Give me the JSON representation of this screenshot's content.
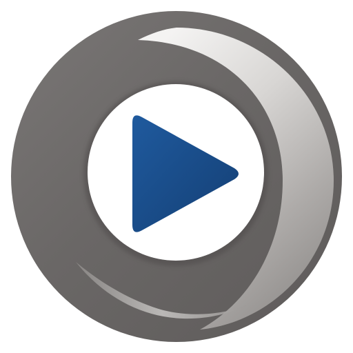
{
  "app": {
    "icon": "play-icon",
    "ring_icon": "ring-logo-icon"
  },
  "colors": {
    "background": "#ffffff",
    "ring_dark": "#6f6c6b",
    "ring_mid": "#9c9997",
    "ring_light": "#d9d7d5",
    "inner_disc": "#ffffff",
    "play_blue": "#1a4e8c"
  }
}
